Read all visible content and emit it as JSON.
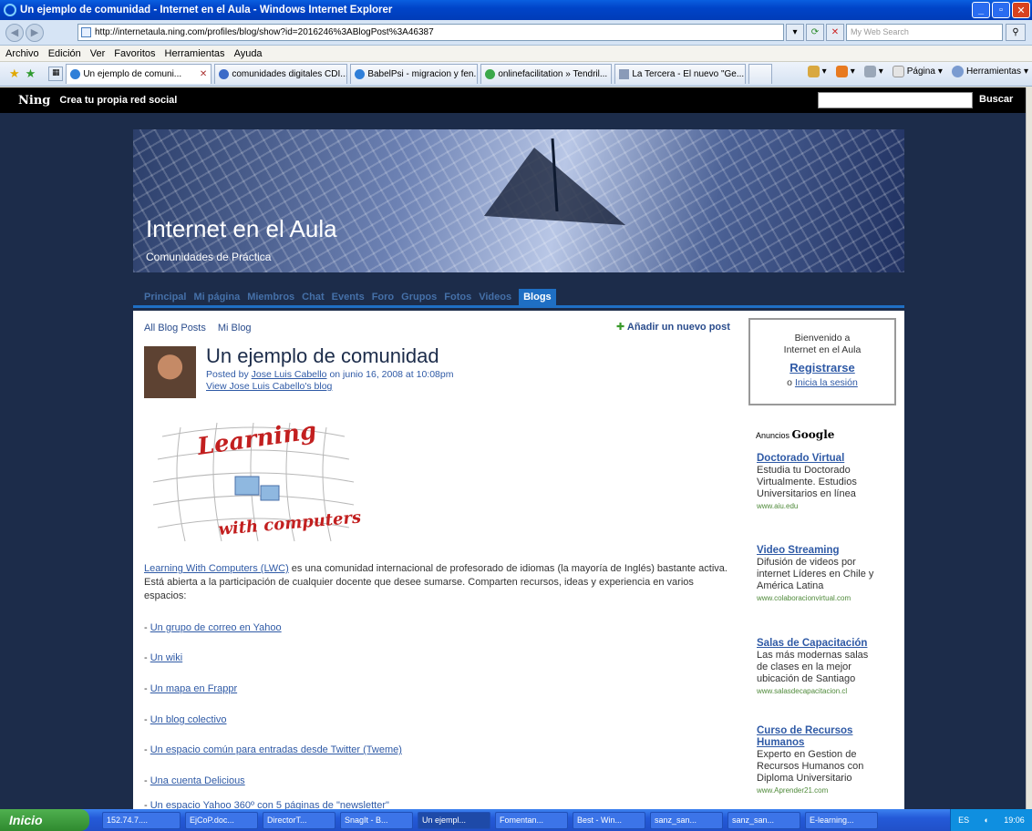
{
  "window": {
    "title": "Un ejemplo de comunidad - Internet en el Aula - Windows Internet Explorer",
    "address": "http://internetaula.ning.com/profiles/blog/show?id=2016246%3ABlogPost%3A46387",
    "search_placeholder": "My Web Search"
  },
  "menu": [
    "Archivo",
    "Edición",
    "Ver",
    "Favoritos",
    "Herramientas",
    "Ayuda"
  ],
  "tabs": [
    {
      "label": "Un ejemplo de comuni...",
      "active": true
    },
    {
      "label": "comunidades digitales CDI...",
      "active": false
    },
    {
      "label": "BabelPsi - migracion y fen...",
      "active": false
    },
    {
      "label": "onlinefacilitation » Tendril...",
      "active": false
    },
    {
      "label": "La Tercera - El nuevo \"Ge...",
      "active": false
    }
  ],
  "tab_tools": {
    "page": "Página",
    "tools": "Herramientas"
  },
  "ning": {
    "logo": "Ning",
    "slogan": "Crea tu propia red social",
    "search_button": "Buscar"
  },
  "site": {
    "title": "Internet en el Aula",
    "subtitle": "Comunidades de Práctica"
  },
  "site_nav": [
    {
      "label": "Principal",
      "active": false
    },
    {
      "label": "Mi página",
      "active": false
    },
    {
      "label": "Miembros",
      "active": false
    },
    {
      "label": "Chat",
      "active": false
    },
    {
      "label": "Events",
      "active": false
    },
    {
      "label": "Foro",
      "active": false
    },
    {
      "label": "Grupos",
      "active": false
    },
    {
      "label": "Fotos",
      "active": false
    },
    {
      "label": "Videos",
      "active": false
    },
    {
      "label": "Blogs",
      "active": true
    }
  ],
  "subnav": {
    "all_posts": "All Blog Posts",
    "my_blog": "Mi Blog",
    "add_post": "Añadir un nuevo post"
  },
  "post": {
    "title": "Un ejemplo de comunidad",
    "posted_by_prefix": "Posted by",
    "author": "Jose Luis Cabello",
    "date_text": "on junio 16, 2008 at 10:08pm",
    "view_blog": "View Jose Luis Cabello's blog",
    "image_text_top": "Learning",
    "image_text_bottom": "with computers",
    "intro_link": "Learning With Computers (LWC)",
    "intro_text": " es una comunidad internacional de profesorado de idiomas (la mayoría de Inglés) bastante activa. Está abierta a la participación de cualquier docente que desee sumarse. Comparten recursos, ideas y experiencia en varios espacios:",
    "items": [
      "Un grupo de correo en Yahoo",
      "Un wiki",
      "Un mapa en Frappr",
      "Un blog colectivo",
      "Un espacio común para entradas desde Twitter (Tweme)",
      "Una cuenta Delicious",
      "Un espacio Yahoo 360º con 5 páginas de \"newsletter\""
    ]
  },
  "welcome": {
    "line1": "Bienvenido a",
    "line2": "Internet en el Aula",
    "register": "Registrarse",
    "or": "o",
    "login": "Inicia la sesión"
  },
  "ads": {
    "label": "Anuncios",
    "brand": "Google",
    "items": [
      {
        "title": "Doctorado Virtual",
        "text": "Estudia tu Doctorado Virtualmente. Estudios Universitarios en línea",
        "url": "www.aiu.edu"
      },
      {
        "title": "Video Streaming",
        "text": "Difusión de videos por internet Líderes en Chile y América Latina",
        "url": "www.colaboracionvirtual.com"
      },
      {
        "title": "Salas de Capacitación",
        "text": "Las más modernas salas de clases en la mejor ubicación de Santiago",
        "url": "www.salasdecapacitacion.cl"
      },
      {
        "title": "Curso de Recursos Humanos",
        "text": "Experto en Gestion de Recursos Humanos con Diploma Universitario",
        "url": "www.Aprender21.com"
      }
    ]
  },
  "taskbar": {
    "start": "Inicio",
    "tasks": [
      {
        "label": "152.74.7....",
        "active": false
      },
      {
        "label": "EjCoP.doc...",
        "active": false
      },
      {
        "label": "DirectorT...",
        "active": false
      },
      {
        "label": "SnagIt - B...",
        "active": false
      },
      {
        "label": "Un ejempl...",
        "active": true
      },
      {
        "label": "Fomentan...",
        "active": false
      },
      {
        "label": "Best - Win...",
        "active": false
      },
      {
        "label": "sanz_san...",
        "active": false
      },
      {
        "label": "sanz_san...",
        "active": false
      },
      {
        "label": "E-learning...",
        "active": false
      }
    ],
    "lang": "ES",
    "clock": "19:06"
  }
}
